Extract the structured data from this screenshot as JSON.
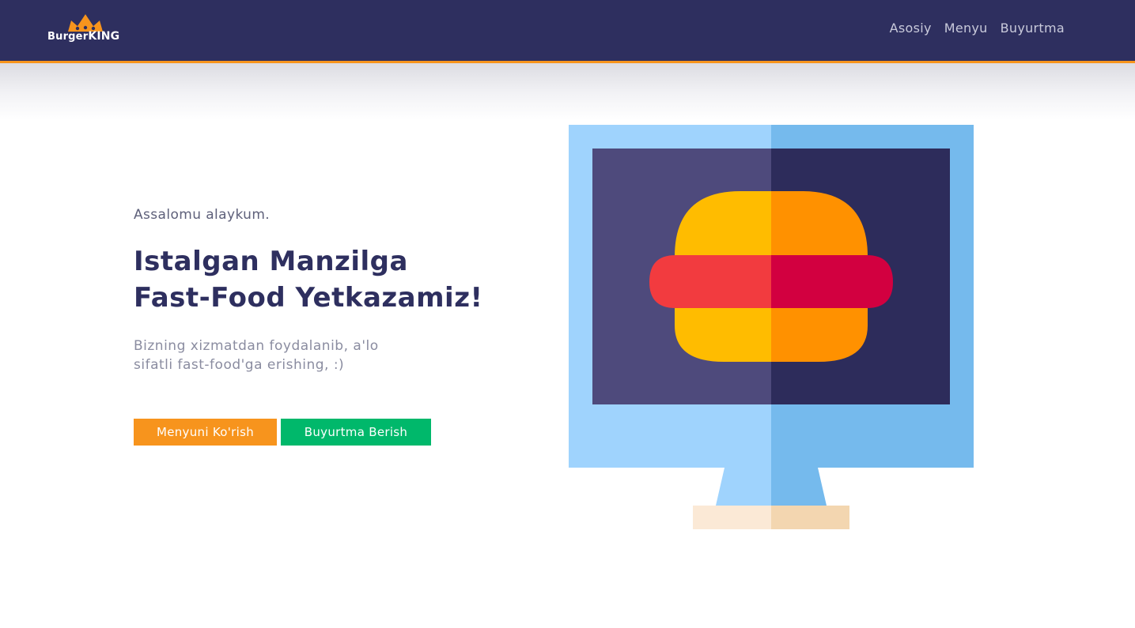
{
  "brand": {
    "logo_main": "Burger",
    "logo_strong": "KING",
    "crown_icon": "crown-icon",
    "accent_color": "#f7941d"
  },
  "nav": {
    "items": [
      {
        "label": "Asosiy"
      },
      {
        "label": "Menyu"
      },
      {
        "label": "Buyurtma"
      }
    ]
  },
  "hero": {
    "greeting": "Assalomu alaykum.",
    "headline_line1": "Istalgan Manzilga",
    "headline_line2": "Fast-Food Yetkazamiz!",
    "subtext_line1": "Bizning xizmatdan foydalanib, a'lo",
    "subtext_line2": "sifatli fast-food'ga erishing, :)"
  },
  "actions": {
    "menu_button": "Menyuni Ko'rish",
    "order_button": "Buyurtma Berish",
    "menu_color": "#f7941d",
    "order_color": "#00b86b"
  },
  "illustration": {
    "icon": "monitor-burger-icon"
  }
}
